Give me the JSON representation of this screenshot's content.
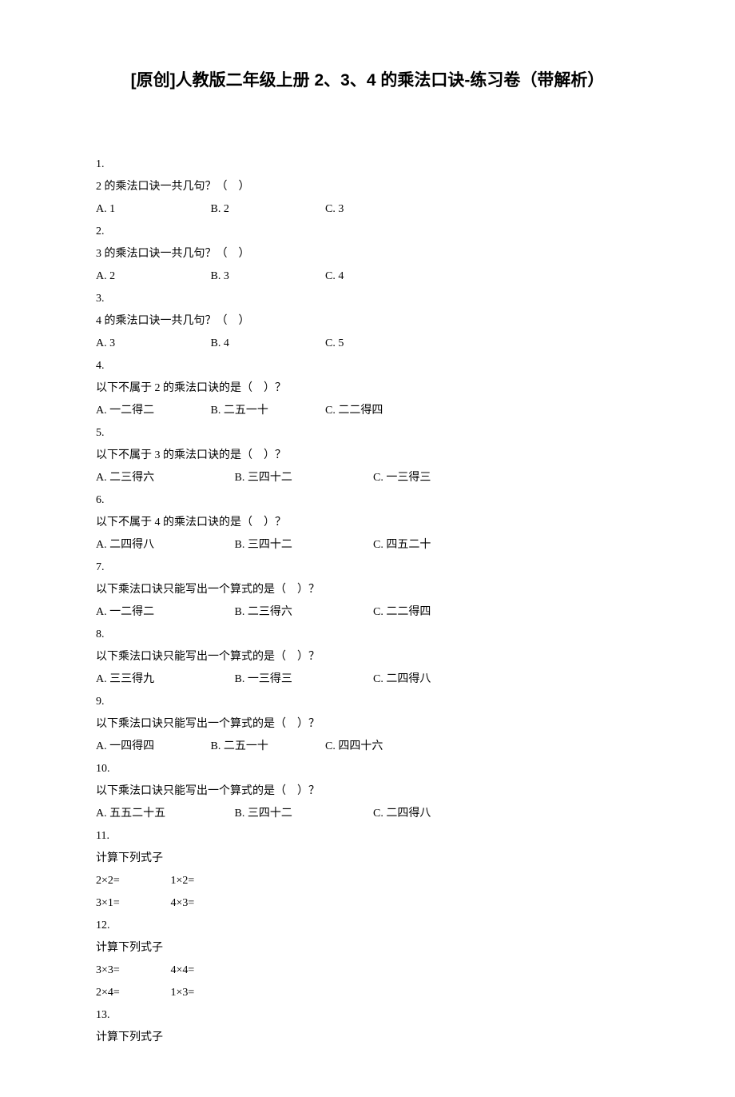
{
  "title": "[原创]人教版二年级上册 2、3、4 的乘法口诀-练习卷（带解析）",
  "q1": {
    "num": "1.",
    "text": "2 的乘法口诀一共几句？（　）",
    "a": "A. 1",
    "b": "B. 2",
    "c": "C. 3"
  },
  "q2": {
    "num": "2.",
    "text": "3 的乘法口诀一共几句？（　）",
    "a": "A. 2",
    "b": "B. 3",
    "c": "C. 4"
  },
  "q3": {
    "num": "3.",
    "text": "4 的乘法口诀一共几句？（　）",
    "a": "A. 3",
    "b": "B. 4",
    "c": "C. 5"
  },
  "q4": {
    "num": "4.",
    "text": "以下不属于 2 的乘法口诀的是（　）？",
    "a": "A. 一二得二",
    "b": "B. 二五一十",
    "c": "C. 二二得四"
  },
  "q5": {
    "num": "5.",
    "text": "以下不属于 3 的乘法口诀的是（　）？",
    "a": "A. 二三得六",
    "b": "B. 三四十二",
    "c": "C.  一三得三"
  },
  "q6": {
    "num": "6.",
    "text": "以下不属于 4 的乘法口诀的是（　）？",
    "a": "A. 二四得八",
    "b": "B. 三四十二",
    "c": "C. 四五二十"
  },
  "q7": {
    "num": "7.",
    "text": "以下乘法口诀只能写出一个算式的是（　）？",
    "a": "A. 一二得二",
    "b": "B. 二三得六",
    "c": "C. 二二得四"
  },
  "q8": {
    "num": "8.",
    "text": "以下乘法口诀只能写出一个算式的是（　）？",
    "a": "A. 三三得九",
    "b": "B. 一三得三",
    "c": "C. 二四得八"
  },
  "q9": {
    "num": "9.",
    "text": "以下乘法口诀只能写出一个算式的是（　）？",
    "a": "A. 一四得四",
    "b": "B. 二五一十",
    "c": "C. 四四十六"
  },
  "q10": {
    "num": "10.",
    "text": "以下乘法口诀只能写出一个算式的是（　）？",
    "a": "A. 五五二十五",
    "b": "B.  三四十二",
    "c": "C. 二四得八"
  },
  "q11": {
    "num": "11.",
    "text": "计算下列式子",
    "r1a": "2×2=",
    "r1b": "1×2=",
    "r2a": "3×1=",
    "r2b": "4×3="
  },
  "q12": {
    "num": "12.",
    "text": "计算下列式子",
    "r1a": "3×3=",
    "r1b": "4×4=",
    "r2a": "2×4=",
    "r2b": "1×3="
  },
  "q13": {
    "num": "13.",
    "text": "计算下列式子"
  }
}
